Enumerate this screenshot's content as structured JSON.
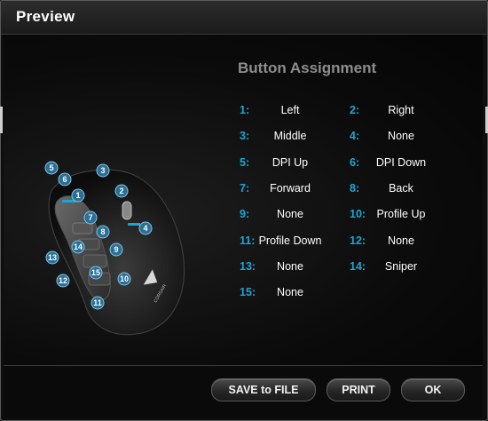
{
  "window": {
    "title": "Preview"
  },
  "panel": {
    "heading": "Button Assignment"
  },
  "assignments": [
    {
      "number": "1:",
      "value": "Left"
    },
    {
      "number": "2:",
      "value": "Right"
    },
    {
      "number": "3:",
      "value": "Middle"
    },
    {
      "number": "4:",
      "value": "None"
    },
    {
      "number": "5:",
      "value": "DPI Up"
    },
    {
      "number": "6:",
      "value": "DPI Down"
    },
    {
      "number": "7:",
      "value": "Forward"
    },
    {
      "number": "8:",
      "value": "Back"
    },
    {
      "number": "9:",
      "value": "None"
    },
    {
      "number": "10:",
      "value": "Profile Up"
    },
    {
      "number": "11:",
      "value": "Profile Down"
    },
    {
      "number": "12:",
      "value": "None"
    },
    {
      "number": "13:",
      "value": "None"
    },
    {
      "number": "14:",
      "value": "Sniper"
    },
    {
      "number": "15:",
      "value": "None"
    }
  ],
  "mouse_callouts": [
    "1",
    "2",
    "3",
    "4",
    "5",
    "6",
    "7",
    "8",
    "9",
    "10",
    "11",
    "12",
    "13",
    "14",
    "15"
  ],
  "mouse_logo_text": "CORSAIR",
  "buttons": {
    "save": "SAVE to FILE",
    "print": "PRINT",
    "ok": "OK"
  },
  "colors": {
    "accent": "#1aa7d6",
    "badge": "#2d6f94"
  }
}
